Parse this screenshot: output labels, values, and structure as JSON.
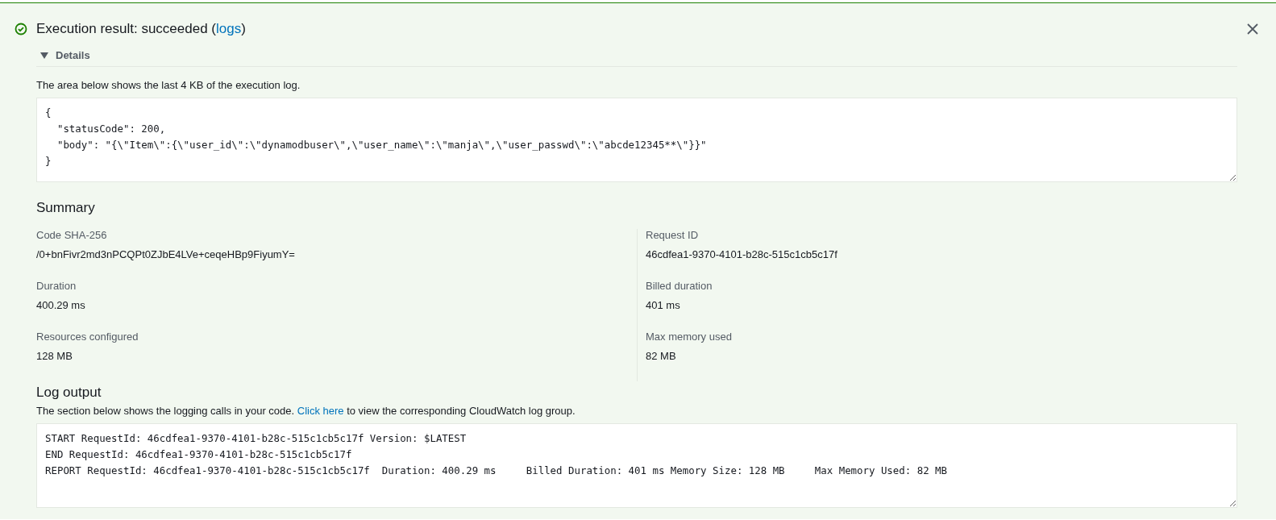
{
  "result": {
    "success": true,
    "title": "Execution result: succeeded (",
    "link": "logs",
    "title_end": ")"
  },
  "details": {
    "label": "Details",
    "expanded": true,
    "note": "The area below shows the last 4 KB of the execution log.",
    "output": "{\n  \"statusCode\": 200,\n  \"body\": \"{\\\"Item\\\":{\\\"user_id\\\":\\\"dynamodbuser\\\",\\\"user_name\\\":\\\"manja\\\",\\\"user_passwd\\\":\\\"abcde12345**\\\"}}\"\n}"
  },
  "summary": {
    "title": "Summary",
    "items": [
      {
        "label": "Code SHA-256",
        "value": "/0+bnFivr2md3nPCQPt0ZJbE4LVe+ceqeHBp9FiyumY="
      },
      {
        "label": "Request ID",
        "value": "46cdfea1-9370-4101-b28c-515c1cb5c17f"
      },
      {
        "label": "Duration",
        "value": "400.29 ms"
      },
      {
        "label": "Billed duration",
        "value": "401 ms"
      },
      {
        "label": "Resources configured",
        "value": "128 MB"
      },
      {
        "label": "Max memory used",
        "value": "82 MB"
      }
    ]
  },
  "log_output": {
    "title": "Log output",
    "note_before": "The section below shows the logging calls in your code.",
    "link": "Click here",
    "note_after": "to view the corresponding CloudWatch log group.",
    "output": "START RequestId: 46cdfea1-9370-4101-b28c-515c1cb5c17f Version: $LATEST\nEND RequestId: 46cdfea1-9370-4101-b28c-515c1cb5c17f\nREPORT RequestId: 46cdfea1-9370-4101-b28c-515c1cb5c17f  Duration: 400.29 ms     Billed Duration: 401 ms Memory Size: 128 MB     Max Memory Used: 82 MB"
  }
}
